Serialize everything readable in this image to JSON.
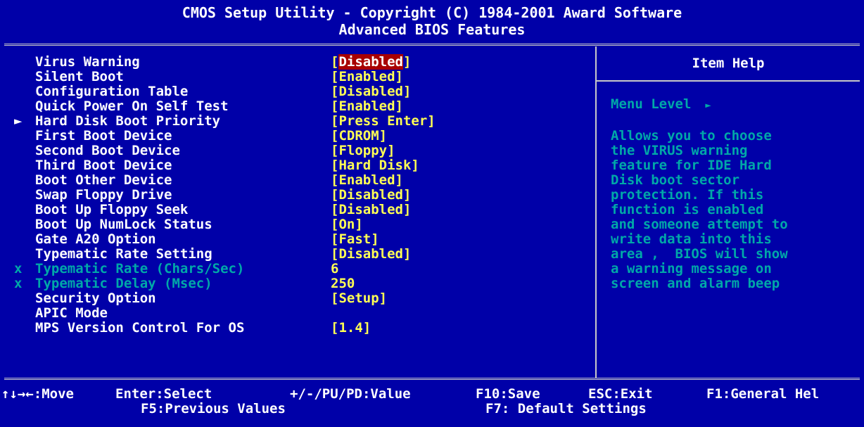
{
  "title": {
    "line1": "CMOS Setup Utility - Copyright (C) 1984-2001 Award Software",
    "line2": "Advanced BIOS Features"
  },
  "items": [
    {
      "mark": "",
      "name": "Virus Warning",
      "open": "[",
      "value": "Disabled",
      "close": "]",
      "dim": false,
      "selected": true
    },
    {
      "mark": "",
      "name": "Silent Boot",
      "open": "[",
      "value": "Enabled",
      "close": "]",
      "dim": false,
      "selected": false
    },
    {
      "mark": "",
      "name": "Configuration Table",
      "open": "[",
      "value": "Disabled",
      "close": "]",
      "dim": false,
      "selected": false
    },
    {
      "mark": "",
      "name": "Quick Power On Self Test",
      "open": "[",
      "value": "Enabled",
      "close": "]",
      "dim": false,
      "selected": false
    },
    {
      "mark": "►",
      "name": "Hard Disk Boot Priority",
      "open": "[",
      "value": "Press Enter",
      "close": "]",
      "dim": false,
      "selected": false
    },
    {
      "mark": "",
      "name": "First Boot Device",
      "open": "[",
      "value": "CDROM",
      "close": "]",
      "dim": false,
      "selected": false
    },
    {
      "mark": "",
      "name": "Second Boot Device",
      "open": "[",
      "value": "Floppy",
      "close": "]",
      "dim": false,
      "selected": false
    },
    {
      "mark": "",
      "name": "Third Boot Device",
      "open": "[",
      "value": "Hard Disk",
      "close": "]",
      "dim": false,
      "selected": false
    },
    {
      "mark": "",
      "name": "Boot Other Device",
      "open": "[",
      "value": "Enabled",
      "close": "]",
      "dim": false,
      "selected": false
    },
    {
      "mark": "",
      "name": "Swap Floppy Drive",
      "open": "[",
      "value": "Disabled",
      "close": "]",
      "dim": false,
      "selected": false
    },
    {
      "mark": "",
      "name": "Boot Up Floppy Seek",
      "open": "[",
      "value": "Disabled",
      "close": "]",
      "dim": false,
      "selected": false
    },
    {
      "mark": "",
      "name": "Boot Up NumLock Status",
      "open": "[",
      "value": "On",
      "close": "]",
      "dim": false,
      "selected": false
    },
    {
      "mark": "",
      "name": "Gate A20 Option",
      "open": "[",
      "value": "Fast",
      "close": "]",
      "dim": false,
      "selected": false
    },
    {
      "mark": "",
      "name": "Typematic Rate Setting",
      "open": "[",
      "value": "Disabled",
      "close": "]",
      "dim": false,
      "selected": false
    },
    {
      "mark": "x",
      "name": "Typematic Rate (Chars/Sec)",
      "open": "",
      "value": "6",
      "close": "",
      "dim": true,
      "selected": false
    },
    {
      "mark": "x",
      "name": "Typematic Delay (Msec)",
      "open": "",
      "value": "250",
      "close": "",
      "dim": true,
      "selected": false
    },
    {
      "mark": "",
      "name": "Security Option",
      "open": "[",
      "value": "Setup",
      "close": "]",
      "dim": false,
      "selected": false
    },
    {
      "mark": "",
      "name": "APIC Mode",
      "open": "",
      "value": "",
      "close": "",
      "dim": false,
      "selected": false
    },
    {
      "mark": "",
      "name": "MPS Version Control For OS",
      "open": "[",
      "value": "1.4",
      "close": "]",
      "dim": false,
      "selected": false
    }
  ],
  "help": {
    "title": "Item Help",
    "menu_level": "Menu Level",
    "menu_arrow": "►",
    "lines": [
      "Allows you to choose",
      "the VIRUS warning",
      "feature for IDE Hard",
      "Disk boot sector",
      "protection. If this",
      "function is enabled",
      "and someone attempt to",
      "write data into this",
      "area ,  BIOS will show",
      "a warning message on",
      "screen and alarm beep"
    ]
  },
  "footer": {
    "move": "↑↓→←:Move",
    "enter": "Enter:Select",
    "value": "+/-/PU/PD:Value",
    "save": "F10:Save",
    "exit": "ESC:Exit",
    "help": "F1:General Hel",
    "prev": "F5:Previous Values",
    "defaults": "F7: Default Settings"
  },
  "colors": {
    "background": "#0000a8",
    "text": "#ffffff",
    "value": "#ffff54",
    "dim": "#00a8a8",
    "selected_bg": "#a80000"
  }
}
